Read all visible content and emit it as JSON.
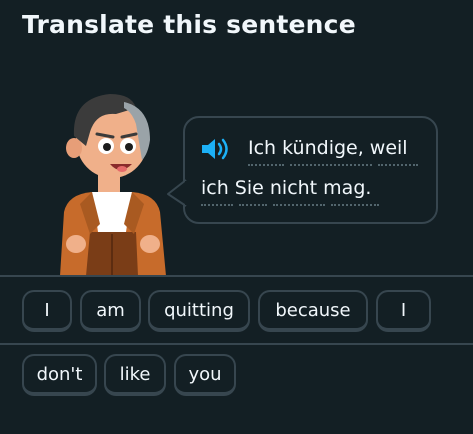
{
  "header": {
    "title": "Translate this sentence"
  },
  "prompt": {
    "icon": "speaker-icon",
    "line1": "Ich kündige, weil",
    "line2": "ich Sie nicht mag.",
    "colors": {
      "speaker": "#1cb0f6",
      "bubble_border": "#37464f",
      "text": "#f1f7fb"
    }
  },
  "word_bank": [
    "I",
    "am",
    "quitting",
    "because",
    "I",
    "don't",
    "like",
    "you"
  ],
  "colors": {
    "background": "#131f24",
    "chip_border": "#37464f"
  }
}
